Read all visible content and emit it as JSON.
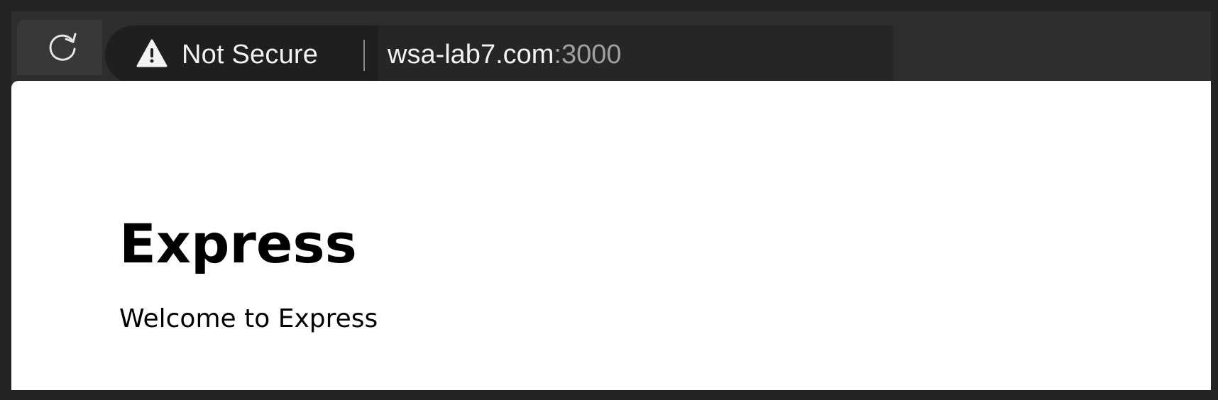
{
  "browser": {
    "reload_icon": "reload-icon",
    "security": {
      "icon": "warning-icon",
      "label": "Not Secure"
    },
    "url": {
      "host": "wsa-lab7.com",
      "port": ":3000"
    }
  },
  "page": {
    "heading": "Express",
    "paragraph": "Welcome to Express"
  },
  "colors": {
    "frame": "#242424",
    "toolbar": "#2d2d2d",
    "address_bar": "#1f1f1f",
    "text_light": "#f2f2f2",
    "port_text": "#a0a0a0",
    "page_background": "#ffffff"
  }
}
